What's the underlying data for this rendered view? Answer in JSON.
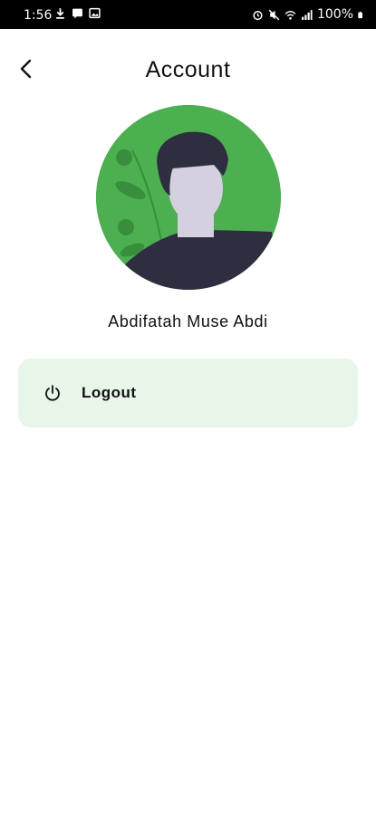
{
  "status_bar": {
    "time": "1:56",
    "battery": "100%",
    "left_icons": [
      "download-icon",
      "message-icon",
      "image-icon"
    ],
    "right_icons": [
      "alarm-icon",
      "mute-icon",
      "wifi-icon",
      "signal-icon",
      "battery-icon"
    ]
  },
  "header": {
    "title": "Account",
    "back_icon": "chevron-left-icon"
  },
  "profile": {
    "name": "Abdifatah Muse Abdi",
    "avatar_bg": "#4caf50"
  },
  "menu": {
    "logout_label": "Logout",
    "logout_icon": "power-icon",
    "logout_bg": "#e8f5e9"
  }
}
